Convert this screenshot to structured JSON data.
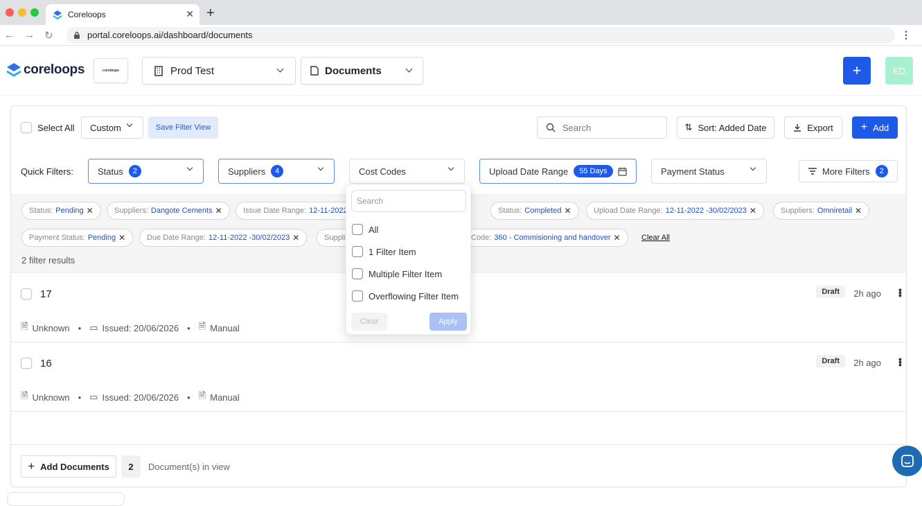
{
  "browser": {
    "tab_title": "Coreloops",
    "url": "portal.coreloops.ai/dashboard/documents"
  },
  "header": {
    "logo_text": "coreloops",
    "org_logo_text": "coreloops",
    "project": "Prod Test",
    "section": "Documents",
    "avatar": "ED",
    "add_label": "+"
  },
  "toolbar": {
    "select_all": "Select All",
    "view": "Custom",
    "save_filter": "Save Filter View",
    "search_placeholder": "Search",
    "sort": "Sort: Added Date",
    "export": "Export",
    "add": "Add"
  },
  "quick_filters": {
    "label": "Quick Filters:",
    "status": "Status",
    "status_count": "2",
    "suppliers": "Suppliers",
    "suppliers_count": "4",
    "cost_codes": "Cost Codes",
    "upload_date": "Upload Date Range",
    "upload_days": "55 Days",
    "payment_status": "Payment Status",
    "more_filters": "More Filters",
    "more_count": "2"
  },
  "chips": [
    {
      "k": "Status:",
      "v": "Pending"
    },
    {
      "k": "Suppliers:",
      "v": "Dangote Cements"
    },
    {
      "k": "Issue Date Range:",
      "v": "12-11-2022"
    },
    {
      "k": "Status:",
      "v": "Completed"
    },
    {
      "k": "Upload Date Range:",
      "v": "12-11-2022 -30/02/2023"
    },
    {
      "k": "Suppliers:",
      "v": "Omniretail"
    },
    {
      "k": "Payment Status:",
      "v": "Pending"
    },
    {
      "k": "Due Date Range:",
      "v": "12-11-2022 -30/02/2023"
    },
    {
      "k": "Supplie",
      "v": ""
    },
    {
      "k": "Code:",
      "v": "360 - Commisioning and handover"
    }
  ],
  "clear_all": "Clear All",
  "results": "2 filter results",
  "documents": [
    {
      "id": "17",
      "supplier": "Unknown",
      "issued": "Issued: 20/06/2026",
      "source": "Manual",
      "status": "Draft",
      "ago": "2h ago"
    },
    {
      "id": "16",
      "supplier": "Unknown",
      "issued": "Issued: 20/06/2026",
      "source": "Manual",
      "status": "Draft",
      "ago": "2h ago"
    }
  ],
  "dropdown": {
    "search_placeholder": "Search",
    "options": [
      "All",
      "1 Filter Item",
      "Multiple Filter Item",
      "Overflowing Filter Item"
    ],
    "clear": "Clear",
    "apply": "Apply"
  },
  "footer": {
    "add_documents": "Add Documents",
    "count": "2",
    "in_view": "Document(s) in view"
  },
  "colors": {
    "primary": "#1d5ae8",
    "avatar_bg": "#a8f0cf"
  }
}
